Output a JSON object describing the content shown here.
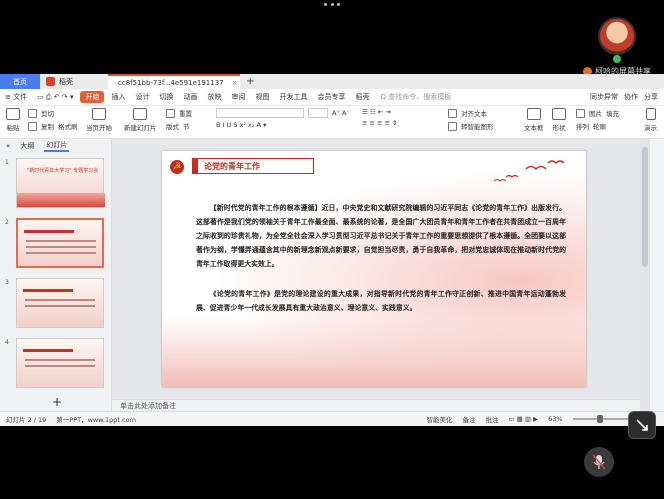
{
  "meeting": {
    "sharer_label": "柯哈的屏幕共享"
  },
  "tabs": [
    {
      "label": "首页"
    },
    {
      "label": "稻壳"
    },
    {
      "label": "cc8f51bb-73f...4e591e191137"
    }
  ],
  "menu": {
    "file": "≡ 文件",
    "items": [
      "开始",
      "插入",
      "设计",
      "切换",
      "动画",
      "放映",
      "审阅",
      "视图",
      "开发工具",
      "会员专享",
      "稻壳"
    ],
    "search_placeholder": "Q 查找命令、搜索模板",
    "right": [
      "同步异常",
      "协作",
      "分享"
    ]
  },
  "ribbon": {
    "paste": "粘贴",
    "cut": "剪切",
    "copy": "复制",
    "format_painter": "格式刷",
    "from_current": "当页开始",
    "new_slide": "新建幻灯片",
    "layout": "版式",
    "section": "节",
    "reset": "重置",
    "text_box": "文本框",
    "shape": "形状",
    "picture": "图片",
    "fill": "填充",
    "arrange": "排列",
    "outline": "轮廓",
    "align_text": "对齐文本",
    "convert_smartart": "转智能图形",
    "present": "演示"
  },
  "left_panel": {
    "tab_outline": "大纲",
    "tab_slides": "幻灯片",
    "thumb_title": "\"新时代青年大学习\" 专题学习会"
  },
  "slide": {
    "heading": "论党的青年工作",
    "paragraph1": "【新时代党的青年工作的根本遵循】近日，中央党史和文献研究院编辑的习近平同志《论党的青年工作》出版发行。这部著作是我们党的领袖关于青年工作最全面、最系统的论著，是全国广大团员青年和青年工作者在共青团成立一百周年之际收到的珍贵礼物，为全党全社会深入学习贯彻习近平总书记关于青年工作的重要思想提供了根本遵循。全团要以这部著作为纲，学懂弄通蕴含其中的新理念新观点新要求，自觉担当尽责，勇于自我革命，把对党忠诚体现在推动新时代党的青年工作取得更大实效上。",
    "paragraph2": "《论党的青年工作》是党的理论建设的重大成果，对指导新时代党的青年工作守正创新、推进中国青年运动蓬勃发展、促进青少年一代成长发展具有重大政治意义、理论意义、实践意义。"
  },
  "notes_placeholder": "单击此处添加备注",
  "status": {
    "slide_count": "幻灯片 2 / 19",
    "theme": "第一PPT，www.1ppt.com",
    "smart_beautify": "智能美化",
    "notes": "备注",
    "comment": "批注",
    "zoom": "63%"
  }
}
